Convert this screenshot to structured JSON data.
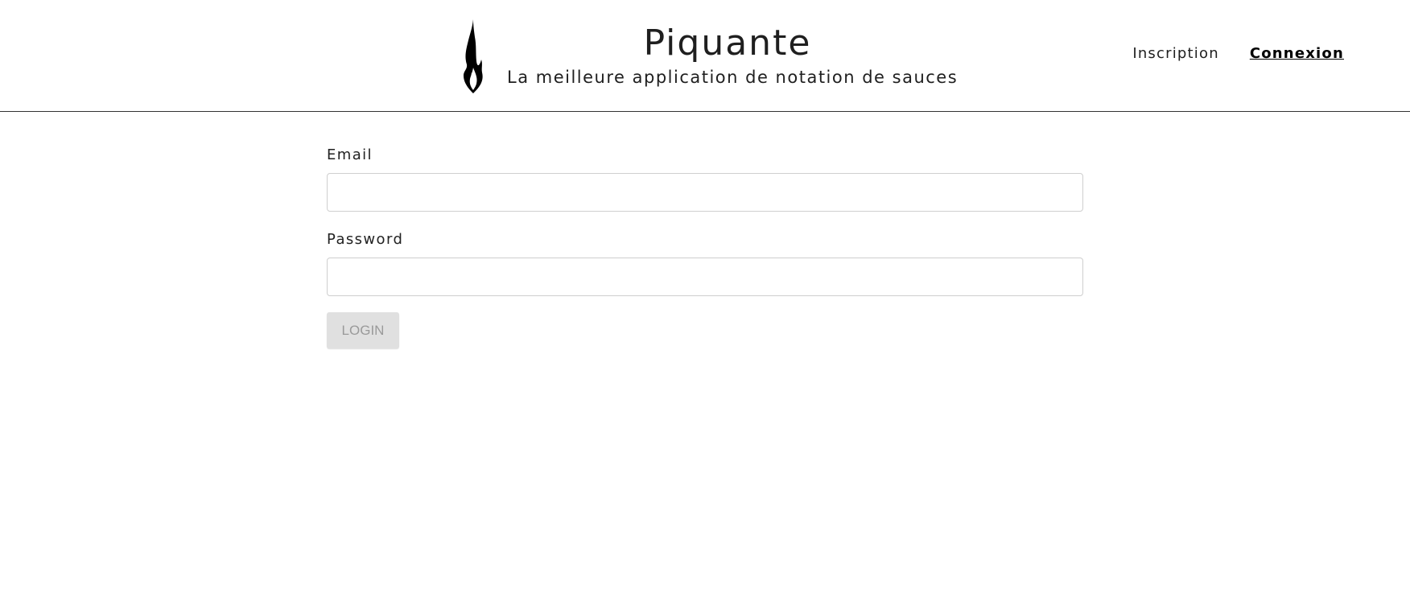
{
  "header": {
    "title": "Piquante",
    "subtitle": "La meilleure application de notation de sauces",
    "logo_icon": "flame-icon"
  },
  "nav": {
    "signup_label": "Inscription",
    "login_label": "Connexion"
  },
  "form": {
    "email_label": "Email",
    "email_value": "",
    "password_label": "Password",
    "password_value": "",
    "submit_label": "LOGIN"
  },
  "colors": {
    "text": "#1f1f1f",
    "divider": "#333333",
    "button_disabled_bg": "#e0e0e0",
    "button_disabled_text": "#9a9a9a",
    "input_border": "#cfcfcf"
  }
}
